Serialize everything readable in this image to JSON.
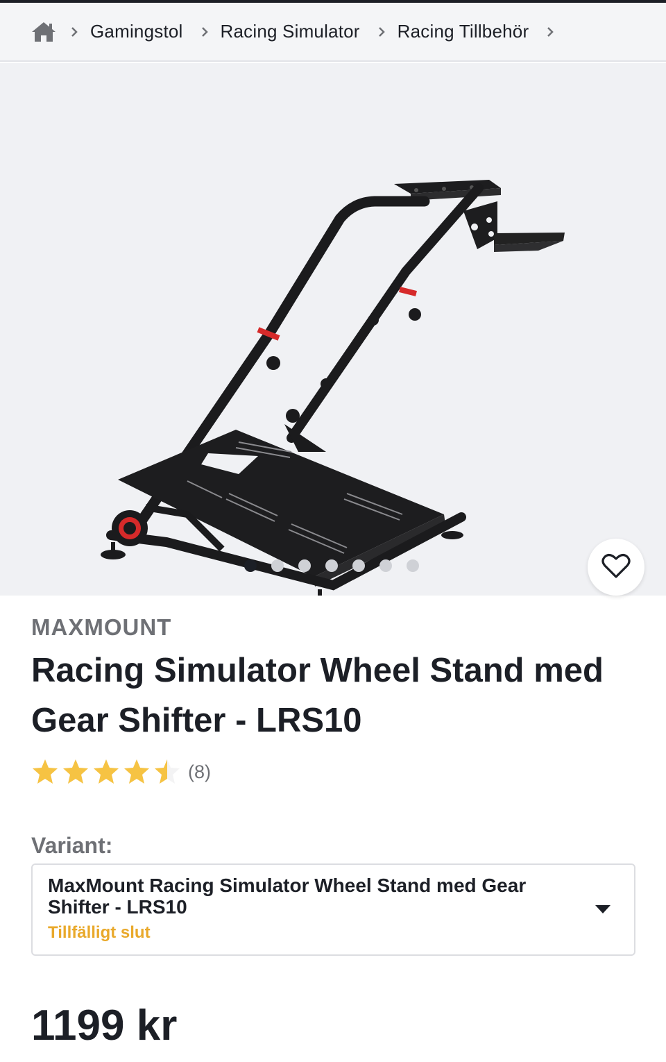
{
  "breadcrumb": {
    "items": [
      {
        "label": "Gamingstol"
      },
      {
        "label": "Racing Simulator"
      },
      {
        "label": "Racing Tillbehör"
      }
    ]
  },
  "gallery": {
    "image_count": 7,
    "active_index": 0
  },
  "product": {
    "brand": "MAXMOUNT",
    "title": "Racing Simulator Wheel Stand med Gear Shifter - LRS10",
    "rating": 4.5,
    "rating_max": 5,
    "review_count": "(8)",
    "variant_label": "Variant:",
    "variant_value": "MaxMount Racing Simulator Wheel Stand med Gear Shifter - LRS10",
    "variant_status": "Tillfälligt slut",
    "price": "1199 kr"
  },
  "colors": {
    "star": "#f6c343",
    "status": "#e9a92b",
    "text": "#1c1f26",
    "muted": "#6e7075"
  }
}
